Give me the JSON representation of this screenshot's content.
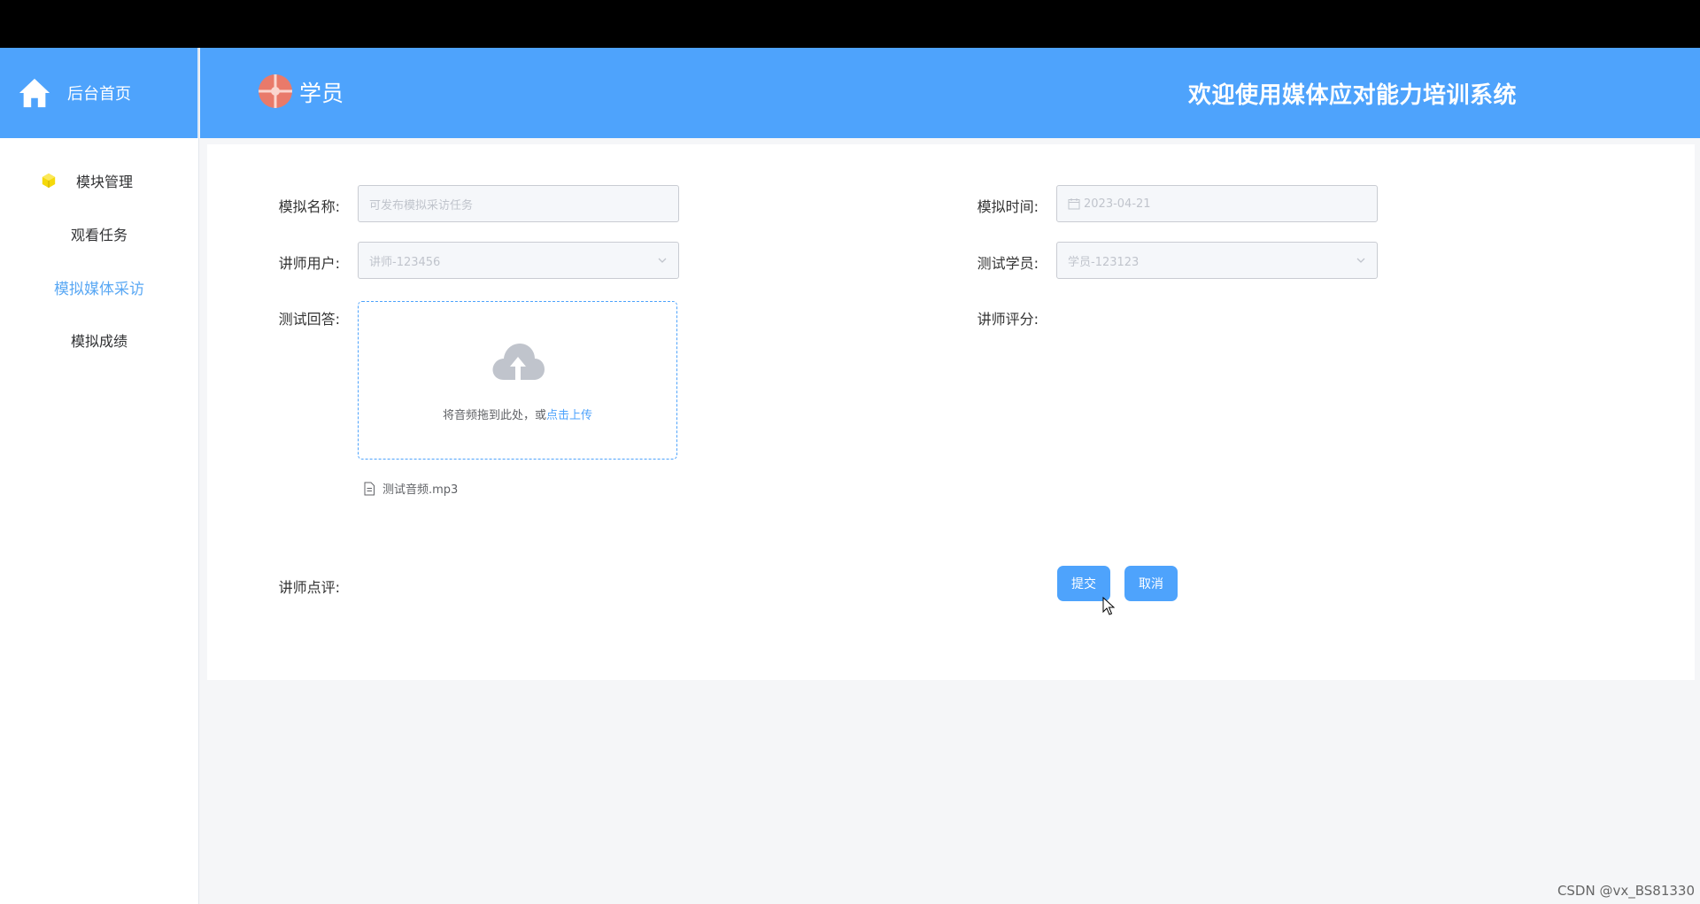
{
  "sidebar": {
    "header_label": "后台首页",
    "menu": [
      {
        "label": "模块管理"
      },
      {
        "label": "观看任务"
      },
      {
        "label": "模拟媒体采访"
      },
      {
        "label": "模拟成绩"
      }
    ]
  },
  "header": {
    "title": "学员",
    "welcome": "欢迎使用媒体应对能力培训系统"
  },
  "form": {
    "name_label": "模拟名称:",
    "name_placeholder": "可发布模拟采访任务",
    "time_label": "模拟时间:",
    "time_value": "2023-04-21",
    "teacher_label": "讲师用户:",
    "teacher_value": "讲师-123456",
    "student_label": "测试学员:",
    "student_value": "学员-123123",
    "answer_label": "测试回答:",
    "score_label": "讲师评分:",
    "upload_text": "将音频拖到此处，或",
    "upload_link": "点击上传",
    "file_name": "测试音频.mp3",
    "comment_label": "讲师点评:",
    "submit_label": "提交",
    "cancel_label": "取消"
  },
  "watermark": "CSDN @vx_BS81330",
  "colors": {
    "primary": "#4ea3fc",
    "active_menu": "#5aa8f4"
  }
}
